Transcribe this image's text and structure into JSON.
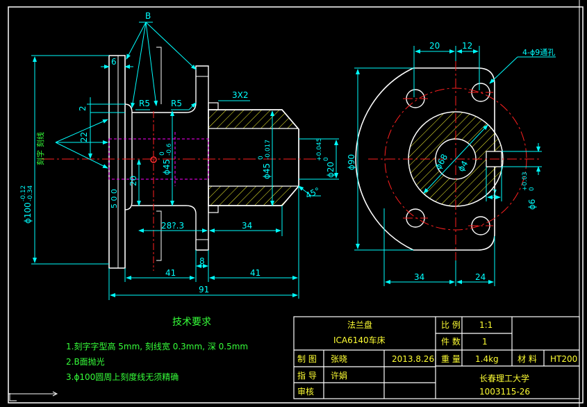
{
  "colors": {
    "background": "#000000",
    "outline": "#ffffff",
    "dimension": "#00ffff",
    "centerline": "#ff2020",
    "hatch": "#ffff33",
    "hidden": "#ff00ff",
    "text": "#36ff3a"
  },
  "front_view": {
    "callouts": {
      "B": "B",
      "r5_left": "R5",
      "r5_right": "R5",
      "groove": "3X2",
      "chamfer": "45°",
      "label_top": "刻线",
      "label_bottom": "刻字"
    },
    "dims": {
      "d6": "6",
      "d2": "2",
      "d22": "22",
      "d20v": "20",
      "d50": "5 0 0",
      "d100": "ϕ100",
      "d100_tol": "-0.12",
      "d100_tol2": "-0.34",
      "d45_left": "ϕ45",
      "d45_left_tol": "0",
      "d45_left_tol2": "-0.6",
      "d45_right": "ϕ45",
      "d45_right_tol": "0",
      "d45_right_tol2": "-0.017",
      "d20_bore": "ϕ20",
      "d20_bore_tol": "+0.045",
      "d20_bore_tol2": "0",
      "d28": "28?.3",
      "d34": "34",
      "d41_left": "41",
      "d8": "8",
      "d41_right": "41",
      "d91": "91"
    }
  },
  "side_view": {
    "dims": {
      "d20": "20",
      "d12": "12",
      "holes": "4-ϕ9通孔",
      "d90": "ϕ90",
      "d68": "ϕ68",
      "d4": "ϕ4",
      "d7": "7",
      "d6": "ϕ6",
      "d6_tol": "+0.03",
      "d6_tol2": "0",
      "d34": "34",
      "d24": "24"
    }
  },
  "tech_requirements": {
    "title": "技术要求",
    "items": [
      "1.刻字字型高 5mm, 刻线宽 0.3mm, 深 0.5mm",
      "2.B面抛光",
      "3.ϕ100圆周上刻度线无须精确"
    ]
  },
  "title_block": {
    "part_name": "法兰盘",
    "model": "ICA6140车床",
    "scale_label": "比 例",
    "scale_value": "1:1",
    "qty_label": "件 数",
    "qty_value": "1",
    "draw_label": "制 图",
    "drafter": "张晓",
    "date": "2013.8.26",
    "weight_label": "重 量",
    "weight_value": "1.4kg",
    "material_label": "材 料",
    "material_value": "HT200",
    "guide_label": "指 导",
    "guide_name": "许娟",
    "check_label": "审核",
    "school": "长春理工大学",
    "drawing_no": "1003115-26"
  }
}
